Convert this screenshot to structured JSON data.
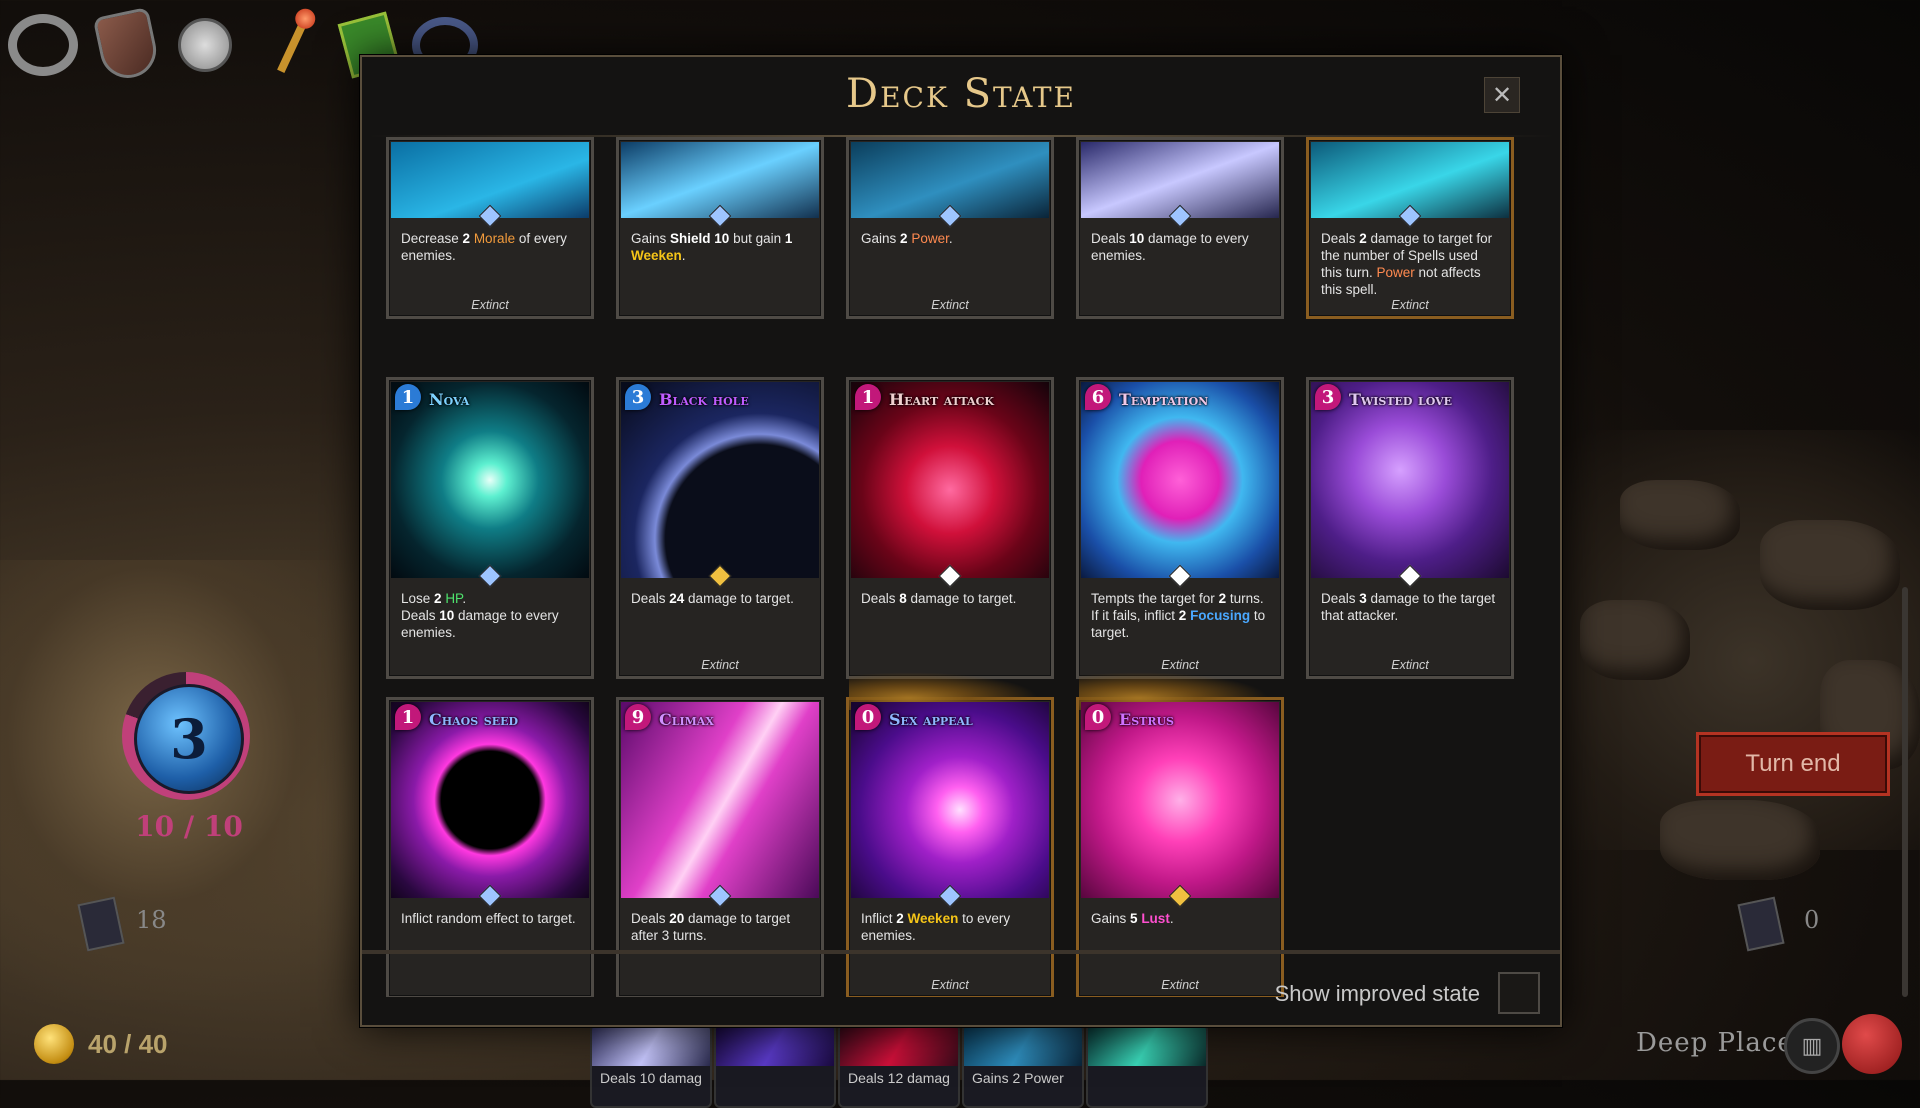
{
  "modal": {
    "title": "Deck State",
    "close_label": "✕",
    "show_improved_label": "Show improved state"
  },
  "colors": {
    "cost_blue": "#2b7bd6",
    "cost_magenta": "#c2187a",
    "turn_end": "#7a1c14",
    "title_gold": "#e6c88a"
  },
  "top_cards": [
    {
      "desc_html": "Decrease <b class='b'>2</b> <span class='kw-morale'>Morale</span> of every enemies.",
      "extinct": "Extinct",
      "art": "linear-gradient(160deg,#0a6fa3,#2ab6e6 60%,#0c3c6a)",
      "gem": "#9ec5ff"
    },
    {
      "desc_html": "Gains <b class='b'>Shield 10</b> but gain <b class='b'>1</b> <span class='kw-weak'>Weeken</span>.",
      "extinct": "",
      "art": "linear-gradient(160deg,#0d3d66,#6ad0ff 50%,#12304e)",
      "gem": "#9ec5ff"
    },
    {
      "desc_html": "Gains <b class='b'>2</b> <span class='kw-power'>Power</span>.",
      "extinct": "Extinct",
      "art": "linear-gradient(160deg,#0b3e5c,#2f8fbf 55%,#0a2438)",
      "gem": "#9ec5ff"
    },
    {
      "desc_html": "Deals <b class='b'>10</b> damage to every enemies.",
      "extinct": "",
      "art": "linear-gradient(160deg,#2a2a6a,#c8c8ff 50%,#26264e)",
      "gem": "#9ec5ff"
    },
    {
      "desc_html": "Deals <b class='b'>2</b> damage to target for the number of Spells used this turn. <span class='kw-power'>Power</span> not affects this spell.",
      "extinct": "Extinct",
      "art": "linear-gradient(160deg,#0c5a7a,#39d6e8 55%,#0d3040)",
      "gem": "#9ec5ff",
      "gold": true
    }
  ],
  "mid_cards": [
    {
      "cost": "1",
      "cost_color": "blue",
      "title": "Nova",
      "title_color": "#7ed2ff",
      "desc_html": "Lose <b class='b'>2</b> <span class='kw-hp'>HP</span>.<br>Deals <b class='b'>10</b> damage to every enemies.",
      "extinct": "",
      "art": "radial-gradient(circle at 50% 50%,#e8fff8 0%,#5df0d0 12%,#0f7d86 35%,#05252e 70%,#020a10 100%)",
      "gem": "#9ec5ff"
    },
    {
      "cost": "3",
      "cost_color": "blue",
      "title": "Black hole",
      "title_color": "#c05cff",
      "desc_html": "Deals <b class='b'>24</b> damage to target.",
      "extinct": "Extinct",
      "art": "radial-gradient(circle at 70% 80%,#0a0d1a 0%,#0a0d1a 45%,#7a8ad8 50%,#1b2660 60%,#070a18 100%)",
      "gem": "#f0c040"
    },
    {
      "cost": "1",
      "cost_color": "magenta",
      "title": "Heart attack",
      "title_color": "#f0d0d0",
      "desc_html": "Deals <b class='b'>8</b> damage to target.",
      "extinct": "",
      "art": "radial-gradient(circle at 50% 55%,#ff6aa0 0%,#d0103a 30%,#6a0418 60%,#14030a 100%)",
      "gem": "#ffffff"
    },
    {
      "cost": "6",
      "cost_color": "magenta",
      "title": "Temptation",
      "title_color": "#f0c8e8",
      "desc_html": "Tempts the target for <b class='b'>2</b> turns. If it fails, inflict <b class='b'>2</b> <span class='kw-focus'>Focusing</span> to target.",
      "extinct": "Extinct",
      "art": "radial-gradient(circle at 50% 50%,#ff60d8 0%,#e020b8 28%,#40b8f0 45%,#1a4fa8 75%,#0a1a40 100%)",
      "gem": "#ffffff"
    },
    {
      "cost": "3",
      "cost_color": "magenta",
      "title": "Twisted love",
      "title_color": "#e0c8f0",
      "desc_html": "Deals <b class='b'>3</b> damage to the target that attacker.",
      "extinct": "Extinct",
      "art": "radial-gradient(circle at 45% 45%,#d6a0ff 0%,#9a4cd8 30%,#4e1e88 60%,#1c0a30 100%)",
      "gem": "#ffffff"
    }
  ],
  "bottom_cards": [
    {
      "cost": "1",
      "cost_color": "magenta",
      "title": "Chaos seed",
      "title_color": "#8fb6ff",
      "desc_html": "Inflict random effect to target.",
      "extinct": "",
      "art": "radial-gradient(circle at 50% 50%,#000 0%,#000 35%,#ff38e0 40%,#8a1aa8 55%,#2a0840 85%,#12041c 100%)",
      "gem": "#9ec5ff",
      "gold": false
    },
    {
      "cost": "9",
      "cost_color": "magenta",
      "title": "Climax",
      "title_color": "#d090ff",
      "desc_html": "Deals <b class='b'>20</b> damage to target after 3 turns.",
      "extinct": "",
      "art": "linear-gradient(120deg,#5a0a6a 0%,#e040c8 40%,#ffd0f4 52%,#e040c8 62%,#4a0a58 100%)",
      "gem": "#9ec5ff",
      "gold": false
    },
    {
      "cost": "0",
      "cost_color": "magenta",
      "title": "Sex appeal",
      "title_color": "#8fb6ff",
      "desc_html": "Inflict <b class='b'>2</b> <span class='kw-weak'>Weeken</span> to every enemies.",
      "extinct": "Extinct",
      "art": "radial-gradient(ellipse at 55% 55%,#ffe0ff 0%,#ff60f0 15%,#a020c8 35%,#4a0c8a 65%,#14042a 100%)",
      "gem": "#9ec5ff",
      "gold": true
    },
    {
      "cost": "0",
      "cost_color": "magenta",
      "title": "Estrus",
      "title_color": "#d070ff",
      "desc_html": "Gains <b class='b'>5</b> <span class='kw-lust'>Lust</span>.",
      "extinct": "Extinct",
      "art": "radial-gradient(circle at 50% 50%,#ffb0e8 0%,#ff40b8 30%,#c01888 60%,#58063e 100%)",
      "gem": "#f0c040",
      "gold": true
    }
  ],
  "hud": {
    "energy": "3",
    "energy_count": "10 / 10",
    "draw_pile": "18",
    "discard_pile": "0",
    "hp": "40 / 40",
    "turn_end_label": "Turn end",
    "location": "Deep Place",
    "book_icon": "book-icon"
  },
  "hand_cards": [
    {
      "text": "Deals 10 damag"
    },
    {
      "text": ""
    },
    {
      "text": "Deals 12 damag"
    },
    {
      "text": "Gains 2 Power"
    },
    {
      "text": ""
    }
  ],
  "relics": [
    "ring-icon",
    "shield-icon",
    "pocket-watch-icon",
    "staff-icon",
    "spellbook-icon",
    "amulet-icon"
  ]
}
